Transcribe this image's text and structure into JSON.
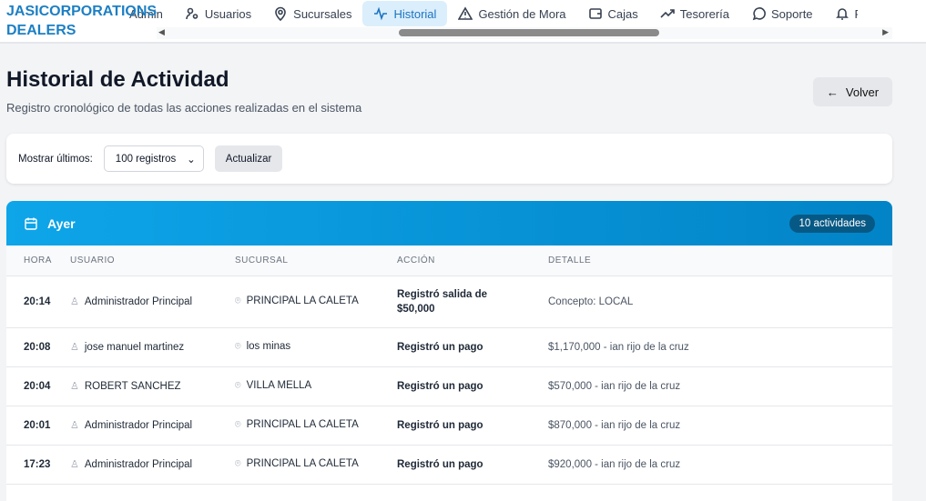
{
  "brand": {
    "line1": "JASICORPORATIONS",
    "line2": "DEALERS"
  },
  "nav": [
    {
      "label": "Admin",
      "icon": "dashboard-icon"
    },
    {
      "label": "Usuarios",
      "icon": "users-icon"
    },
    {
      "label": "Sucursales",
      "icon": "map-pin-icon"
    },
    {
      "label": "Historial",
      "icon": "activity-icon",
      "active": true
    },
    {
      "label": "Gestión de Mora",
      "icon": "warning-icon"
    },
    {
      "label": "Cajas",
      "icon": "wallet-icon"
    },
    {
      "label": "Tesorería",
      "icon": "trending-up-icon"
    },
    {
      "label": "Soporte",
      "icon": "chat-icon"
    },
    {
      "label": "Recordatorios",
      "icon": "bell-icon"
    }
  ],
  "page": {
    "title": "Historial de Actividad",
    "subtitle": "Registro cronológico de todas las acciones realizadas en el sistema",
    "back": "Volver"
  },
  "filter": {
    "label": "Mostrar últimos:",
    "selected": "100 registros",
    "refresh": "Actualizar"
  },
  "group": {
    "title": "Ayer",
    "count": "10 actividades",
    "columns": [
      "HORA",
      "USUARIO",
      "SUCURSAL",
      "ACCIÓN",
      "DETALLE"
    ],
    "rows": [
      {
        "hora": "20:14",
        "usuario": "Administrador Principal",
        "sucursal": "PRINCIPAL LA CALETA",
        "accion": "Registró salida de $50,000",
        "detalle": "Concepto: LOCAL"
      },
      {
        "hora": "20:08",
        "usuario": "jose manuel martinez",
        "sucursal": "los minas",
        "accion": "Registró un pago",
        "detalle": "$1,170,000 - ian rijo de la cruz"
      },
      {
        "hora": "20:04",
        "usuario": "ROBERT SANCHEZ",
        "sucursal": "VILLA MELLA",
        "accion": "Registró un pago",
        "detalle": "$570,000 - ian rijo de la cruz"
      },
      {
        "hora": "20:01",
        "usuario": "Administrador Principal",
        "sucursal": "PRINCIPAL LA CALETA",
        "accion": "Registró un pago",
        "detalle": "$870,000 - ian rijo de la cruz"
      },
      {
        "hora": "17:23",
        "usuario": "Administrador Principal",
        "sucursal": "PRINCIPAL LA CALETA",
        "accion": "Registró un pago",
        "detalle": "$920,000 - ian rijo de la cruz"
      }
    ]
  }
}
